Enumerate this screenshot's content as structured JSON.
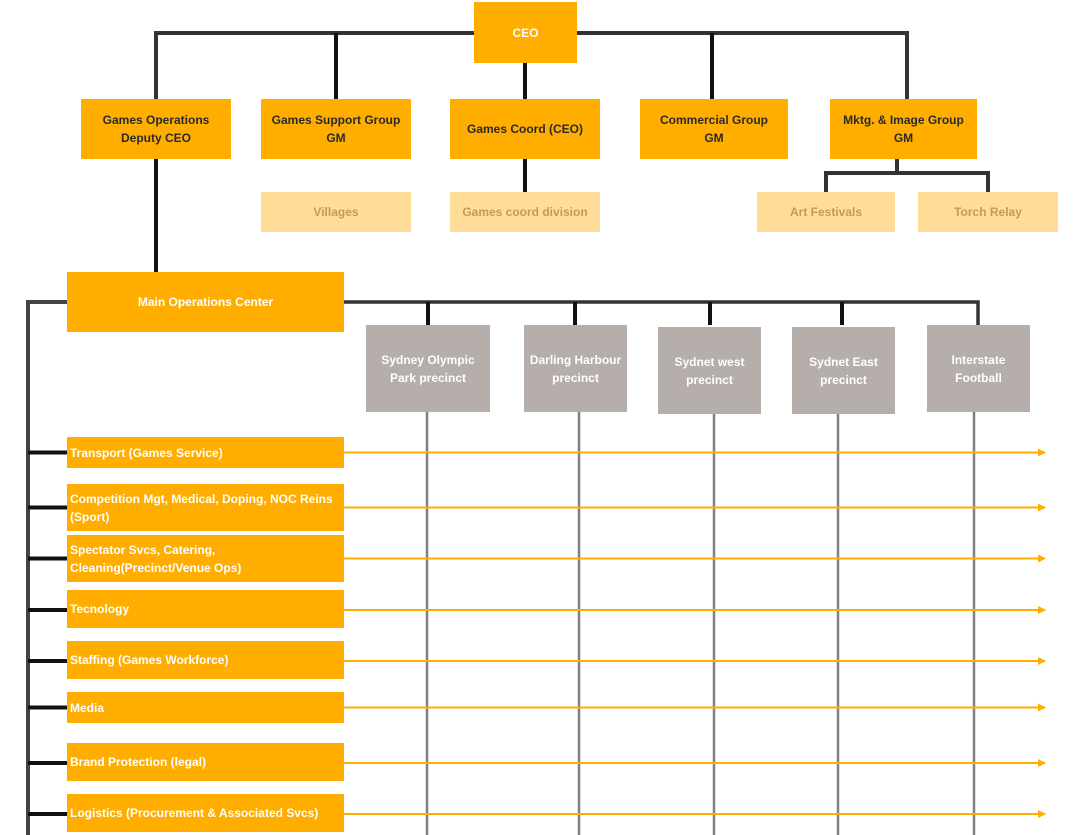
{
  "colors": {
    "primary_box": "#FFAE00",
    "sub_box": "#FFDD99",
    "precinct_box": "#B5AEAB",
    "connector": "#333333",
    "precinct_line": "#808080",
    "arrow": "#FFAE00"
  },
  "top": {
    "ceo": "CEO"
  },
  "groups": [
    {
      "label": "Games Operations Deputy CEO"
    },
    {
      "label": "Games Support Group GM"
    },
    {
      "label": "Games Coord (CEO)"
    },
    {
      "label": "Commercial Group GM"
    },
    {
      "label": "Mktg. & Image Group GM"
    }
  ],
  "sub_units": [
    {
      "label": "Villages",
      "parent": "Games Support Group GM"
    },
    {
      "label": "Games coord division",
      "parent": "Games Coord (CEO)"
    },
    {
      "label": "Art Festivals",
      "parent": "Mktg. & Image Group GM"
    },
    {
      "label": "Torch Relay",
      "parent": "Mktg. & Image Group GM"
    }
  ],
  "operations_center": "Main Operations Center",
  "precincts": [
    {
      "label": "Sydney Olympic Park precinct"
    },
    {
      "label": "Darling Harbour precinct"
    },
    {
      "label": "Sydnet west precinct"
    },
    {
      "label": "Sydnet East precinct"
    },
    {
      "label": "Interstate Football"
    }
  ],
  "functions": [
    {
      "label": "Transport (Games Service)"
    },
    {
      "label": "Competition Mgt, Medical, Doping, NOC Reins (Sport)"
    },
    {
      "label": "Spectator Svcs, Catering, Cleaning(Precinct/Venue Ops)"
    },
    {
      "label": "Tecnology"
    },
    {
      "label": "Staffing (Games Workforce)"
    },
    {
      "label": "Media"
    },
    {
      "label": "Brand Protection (legal)"
    },
    {
      "label": "Logistics (Procurement & Associated Svcs)"
    }
  ]
}
